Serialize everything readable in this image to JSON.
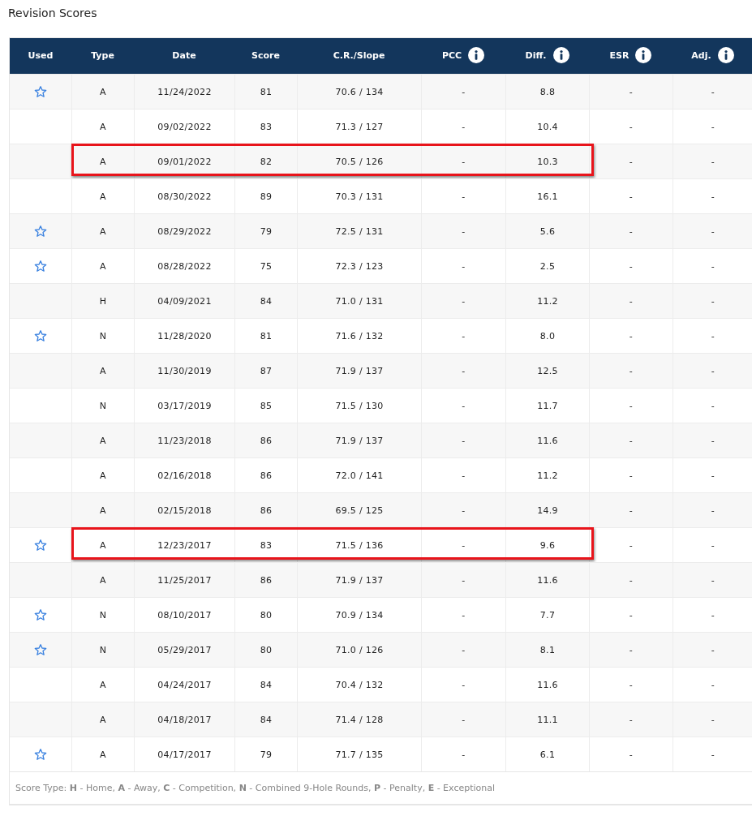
{
  "title": "Revision Scores",
  "columns": [
    {
      "label": "Used",
      "info": false
    },
    {
      "label": "Type",
      "info": false
    },
    {
      "label": "Date",
      "info": false
    },
    {
      "label": "Score",
      "info": false
    },
    {
      "label": "C.R./Slope",
      "info": false
    },
    {
      "label": "PCC",
      "info": true
    },
    {
      "label": "Diff.",
      "info": true
    },
    {
      "label": "ESR",
      "info": true
    },
    {
      "label": "Adj.",
      "info": true
    }
  ],
  "rows": [
    {
      "used": true,
      "highlighted": false,
      "cells": [
        "A",
        "11/24/2022",
        "81",
        "70.6 / 134",
        "-",
        "8.8",
        "-",
        "-"
      ]
    },
    {
      "used": false,
      "highlighted": false,
      "cells": [
        "A",
        "09/02/2022",
        "83",
        "71.3 / 127",
        "-",
        "10.4",
        "-",
        "-"
      ]
    },
    {
      "used": false,
      "highlighted": true,
      "cells": [
        "A",
        "09/01/2022",
        "82",
        "70.5 / 126",
        "-",
        "10.3",
        "-",
        "-"
      ]
    },
    {
      "used": false,
      "highlighted": false,
      "cells": [
        "A",
        "08/30/2022",
        "89",
        "70.3 / 131",
        "-",
        "16.1",
        "-",
        "-"
      ]
    },
    {
      "used": true,
      "highlighted": false,
      "cells": [
        "A",
        "08/29/2022",
        "79",
        "72.5 / 131",
        "-",
        "5.6",
        "-",
        "-"
      ]
    },
    {
      "used": true,
      "highlighted": false,
      "cells": [
        "A",
        "08/28/2022",
        "75",
        "72.3 / 123",
        "-",
        "2.5",
        "-",
        "-"
      ]
    },
    {
      "used": false,
      "highlighted": false,
      "cells": [
        "H",
        "04/09/2021",
        "84",
        "71.0 / 131",
        "-",
        "11.2",
        "-",
        "-"
      ]
    },
    {
      "used": true,
      "highlighted": false,
      "cells": [
        "N",
        "11/28/2020",
        "81",
        "71.6 / 132",
        "-",
        "8.0",
        "-",
        "-"
      ]
    },
    {
      "used": false,
      "highlighted": false,
      "cells": [
        "A",
        "11/30/2019",
        "87",
        "71.9 / 137",
        "-",
        "12.5",
        "-",
        "-"
      ]
    },
    {
      "used": false,
      "highlighted": false,
      "cells": [
        "N",
        "03/17/2019",
        "85",
        "71.5 / 130",
        "-",
        "11.7",
        "-",
        "-"
      ]
    },
    {
      "used": false,
      "highlighted": false,
      "cells": [
        "A",
        "11/23/2018",
        "86",
        "71.9 / 137",
        "-",
        "11.6",
        "-",
        "-"
      ]
    },
    {
      "used": false,
      "highlighted": false,
      "cells": [
        "A",
        "02/16/2018",
        "86",
        "72.0 / 141",
        "-",
        "11.2",
        "-",
        "-"
      ]
    },
    {
      "used": false,
      "highlighted": false,
      "cells": [
        "A",
        "02/15/2018",
        "86",
        "69.5 / 125",
        "-",
        "14.9",
        "-",
        "-"
      ]
    },
    {
      "used": true,
      "highlighted": true,
      "cells": [
        "A",
        "12/23/2017",
        "83",
        "71.5 / 136",
        "-",
        "9.6",
        "-",
        "-"
      ]
    },
    {
      "used": false,
      "highlighted": false,
      "cells": [
        "A",
        "11/25/2017",
        "86",
        "71.9 / 137",
        "-",
        "11.6",
        "-",
        "-"
      ]
    },
    {
      "used": true,
      "highlighted": false,
      "cells": [
        "N",
        "08/10/2017",
        "80",
        "70.9 / 134",
        "-",
        "7.7",
        "-",
        "-"
      ]
    },
    {
      "used": true,
      "highlighted": false,
      "cells": [
        "N",
        "05/29/2017",
        "80",
        "71.0 / 126",
        "-",
        "8.1",
        "-",
        "-"
      ]
    },
    {
      "used": false,
      "highlighted": false,
      "cells": [
        "A",
        "04/24/2017",
        "84",
        "70.4 / 132",
        "-",
        "11.6",
        "-",
        "-"
      ]
    },
    {
      "used": false,
      "highlighted": false,
      "cells": [
        "A",
        "04/18/2017",
        "84",
        "71.4 / 128",
        "-",
        "11.1",
        "-",
        "-"
      ]
    },
    {
      "used": true,
      "highlighted": false,
      "cells": [
        "A",
        "04/17/2017",
        "79",
        "71.7 / 135",
        "-",
        "6.1",
        "-",
        "-"
      ]
    }
  ],
  "legend": "Score Type: **H** - Home, **A** - Away, **C** - Competition, **N** - Combined 9-Hole Rounds, **P** - Penalty, **E** - Exceptional"
}
